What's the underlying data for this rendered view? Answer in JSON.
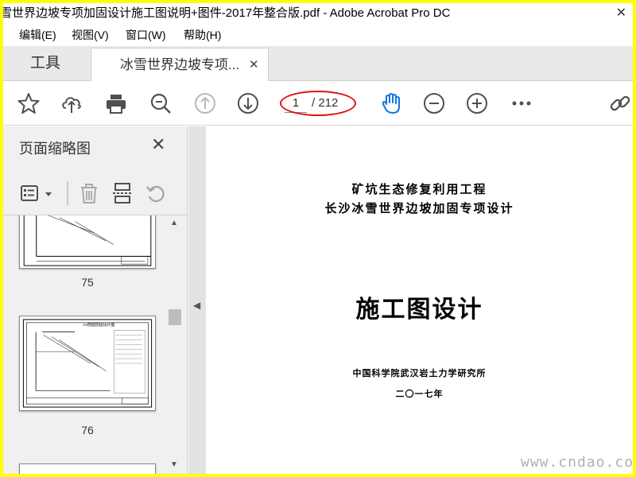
{
  "window": {
    "title": "雪世界边坡专项加固设计施工图说明+图件-2017年整合版.pdf - Adobe Acrobat Pro DC",
    "close_glyph": "✕"
  },
  "menu": [
    "编辑(E)",
    "视图(V)",
    "窗口(W)",
    "帮助(H)"
  ],
  "tabs": {
    "tools_label": "工具",
    "document_tab_label": "冰雪世界边坡专项...",
    "document_tab_close": "✕"
  },
  "toolbar": {
    "page_current": "1",
    "page_total": "/ 212"
  },
  "panel": {
    "title": "页面缩略图",
    "close_glyph": "✕",
    "thumbnails": [
      {
        "page": "75"
      },
      {
        "page": "76"
      }
    ]
  },
  "document": {
    "heading_line1": "矿坑生态修复利用工程",
    "heading_line2": "长沙冰雪世界边坡加固专项设计",
    "main_title": "施工图设计",
    "org": "中国科学院武汉岩土力学研究所",
    "year": "二〇一七年"
  },
  "watermark": "www.cndao.com",
  "colors": {
    "frame_border": "#ffff00",
    "highlight_oval": "#e01010",
    "hand_tool_active": "#1473e6",
    "icon_gray": "#505050"
  },
  "icons": [
    "star-icon",
    "cloud-upload-icon",
    "print-icon",
    "zoom-out-magnifier-icon",
    "page-up-icon",
    "page-down-icon",
    "hand-tool-icon",
    "zoom-out-icon",
    "zoom-in-icon",
    "more-icon",
    "link-icon"
  ]
}
